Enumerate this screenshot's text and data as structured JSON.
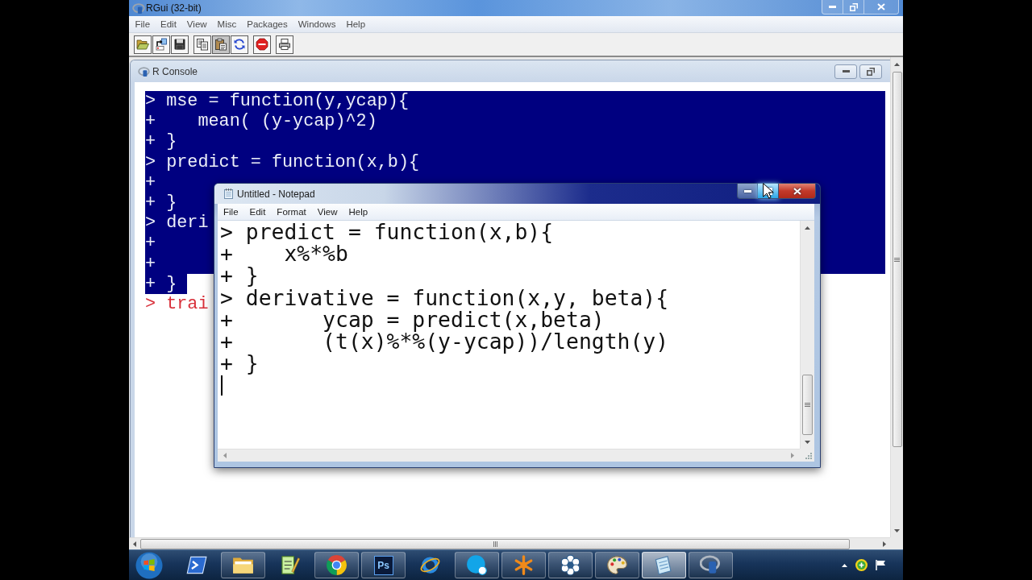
{
  "rgui": {
    "title": "RGui (32-bit)",
    "window_buttons": [
      {
        "kind": "minimize"
      },
      {
        "kind": "restore"
      },
      {
        "kind": "close"
      }
    ],
    "menu": [
      "File",
      "Edit",
      "View",
      "Misc",
      "Packages",
      "Windows",
      "Help"
    ],
    "toolbar_groups": [
      [
        {
          "pressed": false
        },
        {
          "pressed": false
        },
        {
          "pressed": false
        }
      ],
      [
        {
          "pressed": false
        },
        {
          "pressed": true
        },
        {
          "pressed": false
        }
      ],
      [
        {
          "pressed": false
        }
      ],
      [
        {
          "pressed": false
        }
      ]
    ]
  },
  "console": {
    "title": "R Console",
    "window_buttons": [
      {
        "kind": "minimize"
      },
      {
        "kind": "restore"
      }
    ],
    "lines": [
      {
        "text": "> mse = function(y,ycap){",
        "selected": true
      },
      {
        "text": "+    mean( (y-ycap)^2)",
        "selected": true
      },
      {
        "text": "+ }",
        "selected": true
      },
      {
        "text": "> predict = function(x,b){",
        "selected": true
      },
      {
        "text": "+",
        "selected": true
      },
      {
        "text": "+ }",
        "selected": true
      },
      {
        "text": "> deri",
        "selected": true
      },
      {
        "text": "+",
        "selected": true
      },
      {
        "text": "+",
        "selected": true
      },
      {
        "text": "+ }",
        "selected": true
      },
      {
        "text": "> trai",
        "selected": false
      }
    ]
  },
  "notepad": {
    "title": "Untitled - Notepad",
    "window_buttons": [
      {
        "kind": "minimize",
        "hovered": false
      },
      {
        "kind": "maximize",
        "hovered": true
      },
      {
        "kind": "close",
        "hovered": false
      }
    ],
    "menu": [
      "File",
      "Edit",
      "Format",
      "View",
      "Help"
    ],
    "lines": [
      "> predict = function(x,b){",
      "+    x%*%b",
      "+ }",
      "> derivative = function(x,y, beta){",
      "+       ycap = predict(x,beta)",
      "+       (t(x)%*%(y-ycap))/length(y)",
      "+ }"
    ]
  },
  "taskbar": {
    "buttons": [
      {
        "running": false,
        "selected": false
      },
      {
        "running": true,
        "selected": false
      },
      {
        "running": false,
        "selected": false
      },
      {
        "running": true,
        "selected": false
      },
      {
        "running": true,
        "selected": false,
        "label": "Ps"
      },
      {
        "running": false,
        "selected": false
      },
      {
        "running": true,
        "selected": false
      },
      {
        "running": true,
        "selected": false
      },
      {
        "running": true,
        "selected": false
      },
      {
        "running": true,
        "selected": false
      },
      {
        "running": true,
        "selected": true
      },
      {
        "running": true,
        "selected": false
      }
    ]
  }
}
